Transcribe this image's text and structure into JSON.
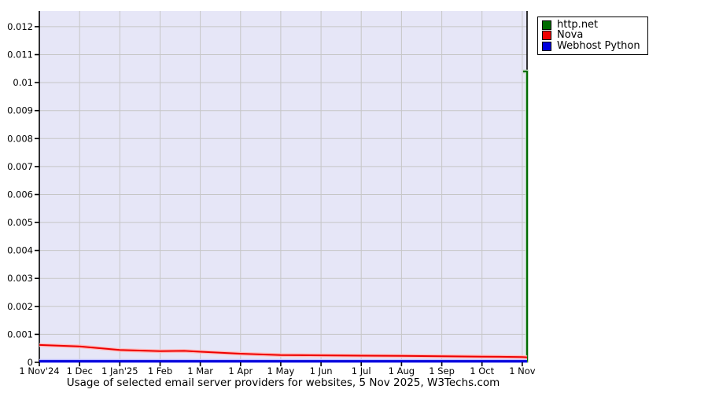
{
  "colors": {
    "page_bg": "#ffffff",
    "plot_bg": "#e6e6f7",
    "grid": "#c6c6c6",
    "axis": "#000000",
    "text": "#000000",
    "legend_border": "#000000"
  },
  "chart_data": {
    "type": "line",
    "caption": "Usage of selected email server providers for websites, 5 Nov 2025, W3Techs.com",
    "grid": true,
    "legend_position": "top-right",
    "xlim": [
      0,
      12.12
    ],
    "ylim": [
      0,
      0.01256
    ],
    "x_tick_labels": [
      "1 Nov'24",
      "1 Dec",
      "1 Jan'25",
      "1 Feb",
      "1 Mar",
      "1 Apr",
      "1 May",
      "1 Jun",
      "1 Jul",
      "1 Aug",
      "1 Sep",
      "1 Oct",
      "1 Nov"
    ],
    "y_tick_values": [
      0,
      0.001,
      0.002,
      0.003,
      0.004,
      0.005,
      0.006,
      0.007,
      0.008,
      0.009,
      0.01,
      0.011,
      0.012
    ],
    "y_tick_labels": [
      "0",
      "0.001",
      "0.002",
      "0.003",
      "0.004",
      "0.005",
      "0.006",
      "0.007",
      "0.008",
      "0.009",
      "0.01",
      "0.011",
      "0.012"
    ],
    "series": [
      {
        "name": "http.net",
        "slug": "http-net",
        "color": "#006a00",
        "shadow": "#b8d8b8",
        "width": 2,
        "x": [
          0,
          1,
          2,
          3,
          4,
          5,
          6,
          7,
          8,
          9,
          10,
          11,
          12,
          12.12,
          12.12,
          12.02
        ],
        "y": [
          4e-05,
          4e-05,
          4e-05,
          4e-05,
          4e-05,
          4e-05,
          4e-05,
          4e-05,
          4e-05,
          4e-05,
          4e-05,
          4e-05,
          4e-05,
          4e-05,
          0.0104,
          0.0104
        ]
      },
      {
        "name": "Nova",
        "slug": "nova",
        "color": "#ee0000",
        "shadow": "#ffb8b8",
        "width": 2,
        "x": [
          0,
          1,
          2,
          3,
          3.6,
          4,
          5,
          6,
          7,
          8,
          9,
          10,
          11,
          12,
          12.12
        ],
        "y": [
          0.00062,
          0.00057,
          0.00044,
          0.0004,
          0.00041,
          0.00038,
          0.00031,
          0.00026,
          0.00025,
          0.00024,
          0.00023,
          0.00022,
          0.000205,
          0.00019,
          0.00018
        ]
      },
      {
        "name": "Webhost Python",
        "slug": "webhost-python",
        "color": "#0000dd",
        "shadow": "#c0c0ff",
        "width": 3,
        "x": [
          0,
          12.12
        ],
        "y": [
          4e-05,
          4e-05
        ]
      }
    ]
  }
}
